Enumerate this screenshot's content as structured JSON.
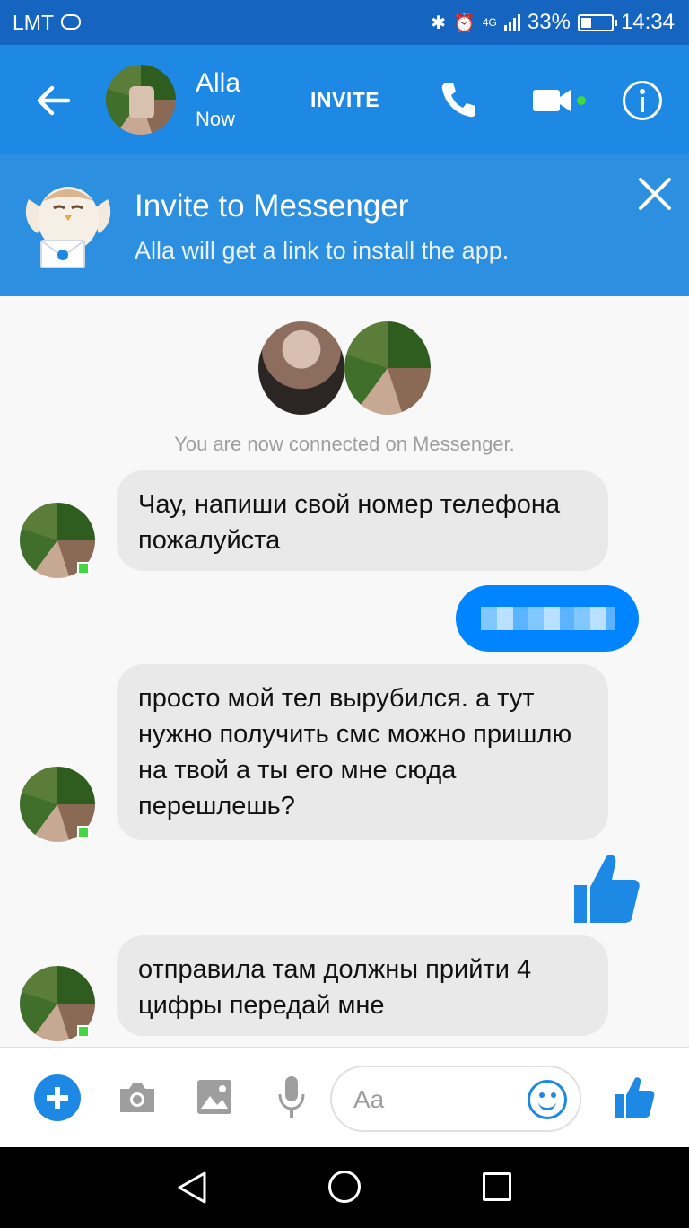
{
  "status_bar": {
    "carrier": "LMT",
    "network": "4G",
    "battery": "33%",
    "time": "14:34"
  },
  "header": {
    "name": "Alla",
    "status": "Now",
    "invite_label": "INVITE"
  },
  "banner": {
    "title": "Invite to Messenger",
    "subtitle": "Alla will get a link to install the app."
  },
  "chat": {
    "connected_text": "You are now connected on Messenger.",
    "messages": [
      {
        "sender": "Alla",
        "text": "Чау, напиши свой номер телефона пожалуйста"
      },
      {
        "sender": "me",
        "text": ""
      },
      {
        "sender": "Alla",
        "text": "просто мой тел вырубился. а тут нужно получить смс можно пришлю на твой а ты его мне сюда перешлешь?"
      },
      {
        "sender": "me",
        "sticker": "like-icon"
      },
      {
        "sender": "Alla",
        "text": "отправила там должны прийти 4 цифры передай мне"
      }
    ]
  },
  "composer": {
    "placeholder": "Aa"
  },
  "colors": {
    "header": "#1e88e5",
    "status_bar": "#1565c0",
    "banner": "#2d8fdf",
    "accent": "#0084ff",
    "bubble_received": "#e9e9ea"
  }
}
